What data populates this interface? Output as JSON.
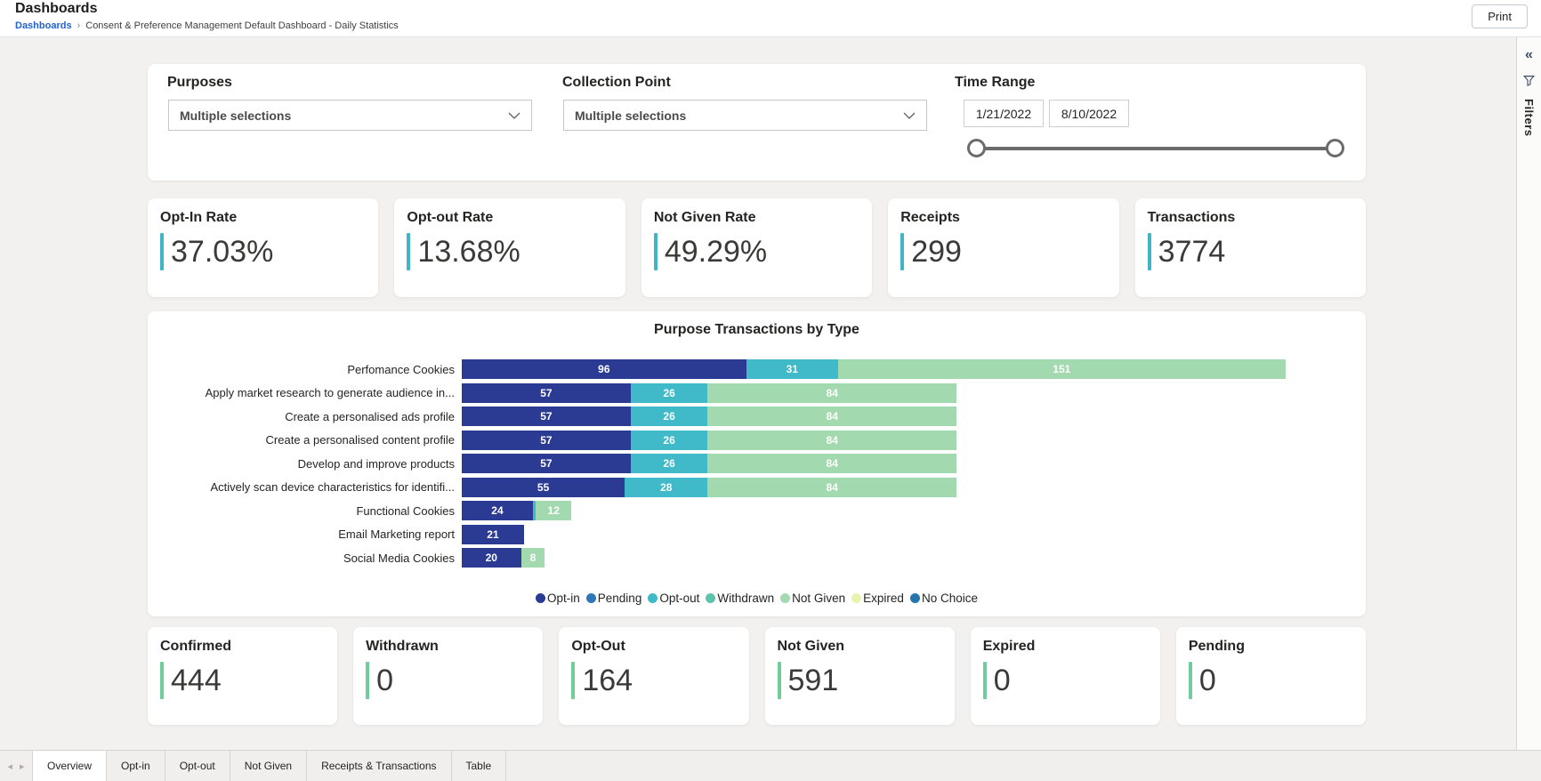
{
  "header": {
    "title": "Dashboards",
    "breadcrumb": {
      "root": "Dashboards",
      "separator": "›",
      "current": "Consent & Preference Management Default Dashboard - Daily Statistics"
    },
    "print_label": "Print"
  },
  "filters_rail": {
    "collapse_glyph": "«",
    "funnel_icon": "filter-funnel-icon",
    "label": "Filters"
  },
  "filter_bar": {
    "purposes": {
      "label": "Purposes",
      "value": "Multiple selections"
    },
    "collection_point": {
      "label": "Collection Point",
      "value": "Multiple selections"
    },
    "time_range": {
      "label": "Time Range",
      "start_date": "1/21/2022",
      "end_date": "8/10/2022"
    }
  },
  "kpi_top": {
    "accent_color": "#3fb6c5",
    "cards": [
      {
        "label": "Opt-In Rate",
        "value": "37.03%"
      },
      {
        "label": "Opt-out Rate",
        "value": "13.68%"
      },
      {
        "label": "Not Given Rate",
        "value": "49.29%"
      },
      {
        "label": "Receipts",
        "value": "299"
      },
      {
        "label": "Transactions",
        "value": "3774"
      }
    ]
  },
  "chart_data": {
    "type": "bar",
    "orientation": "horizontal",
    "stacked": true,
    "title": "Purpose Transactions by Type",
    "xlim": [
      0,
      300
    ],
    "legend_position": "bottom",
    "value_labels": true,
    "categories": [
      "Perfomance Cookies",
      "Apply market research to generate audience in...",
      "Create a personalised ads profile",
      "Create a personalised content profile",
      "Develop and improve products",
      "Actively scan device characteristics for identifi...",
      "Functional Cookies",
      "Email Marketing report",
      "Social Media Cookies"
    ],
    "series": [
      {
        "name": "Opt-in",
        "color": "#2b3b94",
        "values": [
          96,
          57,
          57,
          57,
          57,
          55,
          24,
          21,
          20
        ]
      },
      {
        "name": "Pending",
        "color": "#2e76b5",
        "values": [
          0,
          0,
          0,
          0,
          0,
          0,
          0,
          0,
          0
        ]
      },
      {
        "name": "Opt-out",
        "color": "#40b9c9",
        "values": [
          31,
          26,
          26,
          26,
          26,
          28,
          1,
          0,
          0
        ]
      },
      {
        "name": "Withdrawn",
        "color": "#5ec3ad",
        "values": [
          0,
          0,
          0,
          0,
          0,
          0,
          0,
          0,
          0
        ]
      },
      {
        "name": "Not Given",
        "color": "#a3d9ae",
        "values": [
          151,
          84,
          84,
          84,
          84,
          84,
          12,
          0,
          8
        ]
      },
      {
        "name": "Expired",
        "color": "#e9f3ae",
        "values": [
          0,
          0,
          0,
          0,
          0,
          0,
          0,
          0,
          0
        ]
      },
      {
        "name": "No Choice",
        "color": "#2474ae",
        "values": [
          0,
          0,
          0,
          0,
          0,
          0,
          0,
          0,
          0
        ]
      }
    ]
  },
  "kpi_bottom": {
    "accent_color": "#6fcd9b",
    "cards": [
      {
        "label": "Confirmed",
        "value": "444"
      },
      {
        "label": "Withdrawn",
        "value": "0"
      },
      {
        "label": "Opt-Out",
        "value": "164"
      },
      {
        "label": "Not Given",
        "value": "591"
      },
      {
        "label": "Expired",
        "value": "0"
      },
      {
        "label": "Pending",
        "value": "0"
      }
    ]
  },
  "tabs": {
    "prev_glyph": "◂",
    "next_glyph": "▸",
    "active": "Overview",
    "items": [
      "Overview",
      "Opt-in",
      "Opt-out",
      "Not Given",
      "Receipts & Transactions",
      "Table"
    ]
  }
}
